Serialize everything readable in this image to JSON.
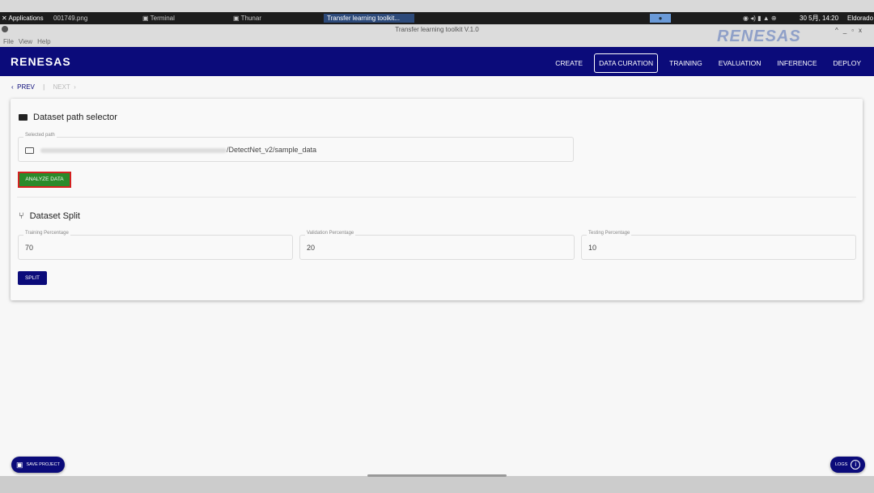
{
  "taskbar": {
    "apps": "Applications",
    "items": [
      "001749.png",
      "Terminal",
      "Thunar",
      "Transfer learning toolkit..."
    ],
    "clock": "30 5月, 14:20",
    "user": "Eldorado"
  },
  "window": {
    "title": "Transfer learning toolkit V.1.0",
    "menu": [
      "File",
      "View",
      "Help"
    ],
    "logo": "RENESAS"
  },
  "appbar": {
    "logo": "RENESAS",
    "nav": [
      "CREATE",
      "DATA CURATION",
      "TRAINING",
      "EVALUATION",
      "INFERENCE",
      "DEPLOY"
    ],
    "active": "DATA CURATION"
  },
  "pager": {
    "prev": "PREV",
    "next": "NEXT"
  },
  "path_section": {
    "title": "Dataset path selector",
    "field_label": "Selected path",
    "path_suffix": "/DetectNet_v2/sample_data",
    "analyze_label": "ANALYZE DATA"
  },
  "split_section": {
    "title": "Dataset Split",
    "fields": [
      {
        "label": "Training Percentage",
        "value": "70"
      },
      {
        "label": "Validation Percentage",
        "value": "20"
      },
      {
        "label": "Testing Percentage",
        "value": "10"
      }
    ],
    "split_label": "SPLIT"
  },
  "footer": {
    "save_label": "SAVE PROJECT",
    "logs_label": "LOGS"
  }
}
